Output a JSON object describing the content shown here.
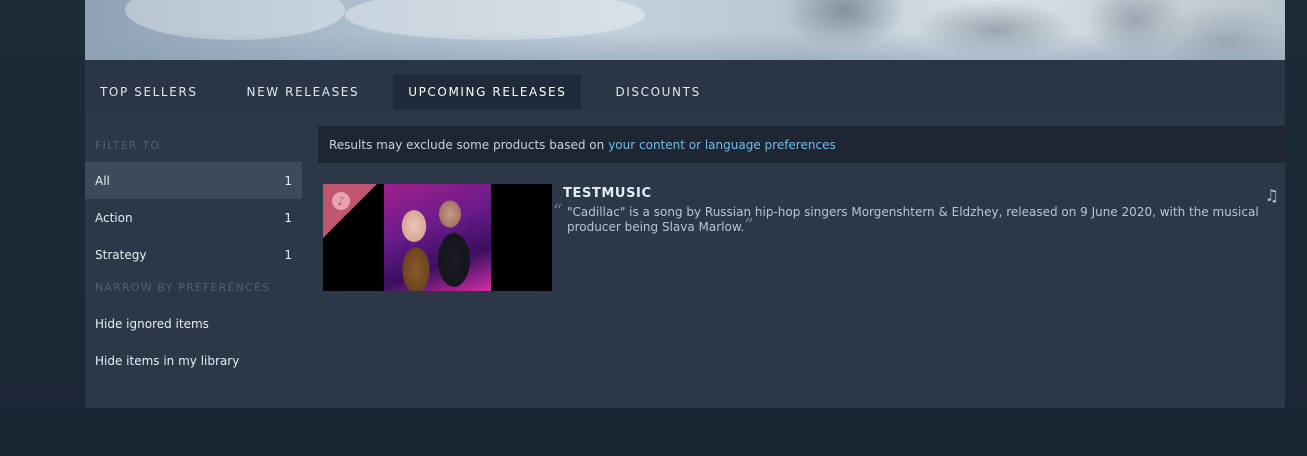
{
  "tabs": [
    {
      "label": "TOP SELLERS"
    },
    {
      "label": "NEW RELEASES"
    },
    {
      "label": "UPCOMING RELEASES",
      "active": true
    },
    {
      "label": "DISCOUNTS"
    }
  ],
  "sidebar": {
    "filter_heading": "FILTER TO",
    "filters": [
      {
        "label": "All",
        "count": "1"
      },
      {
        "label": "Action",
        "count": "1"
      },
      {
        "label": "Strategy",
        "count": "1"
      }
    ],
    "narrow_heading": "NARROW BY PREFERENCES",
    "preferences": [
      {
        "label": "Hide ignored items"
      },
      {
        "label": "Hide items in my library"
      }
    ]
  },
  "notice": {
    "text": "Results may exclude some products based on",
    "link": "your content or language preferences"
  },
  "result": {
    "title": "TESTMUSIC",
    "description": "\"Cadillac\" is a song by Russian hip-hop singers Morgenshtern & Eldzhey, released on 9 June 2020, with the musical producer being Slava Marlow.",
    "type_icon": "music-note-icon",
    "ribbon_icon": "music-note-icon"
  },
  "colors": {
    "background": "#1b2838",
    "tab_bar": "#2a3646",
    "panel": "#2b3847",
    "link": "#66c0f4",
    "ribbon": "#c0576f"
  }
}
